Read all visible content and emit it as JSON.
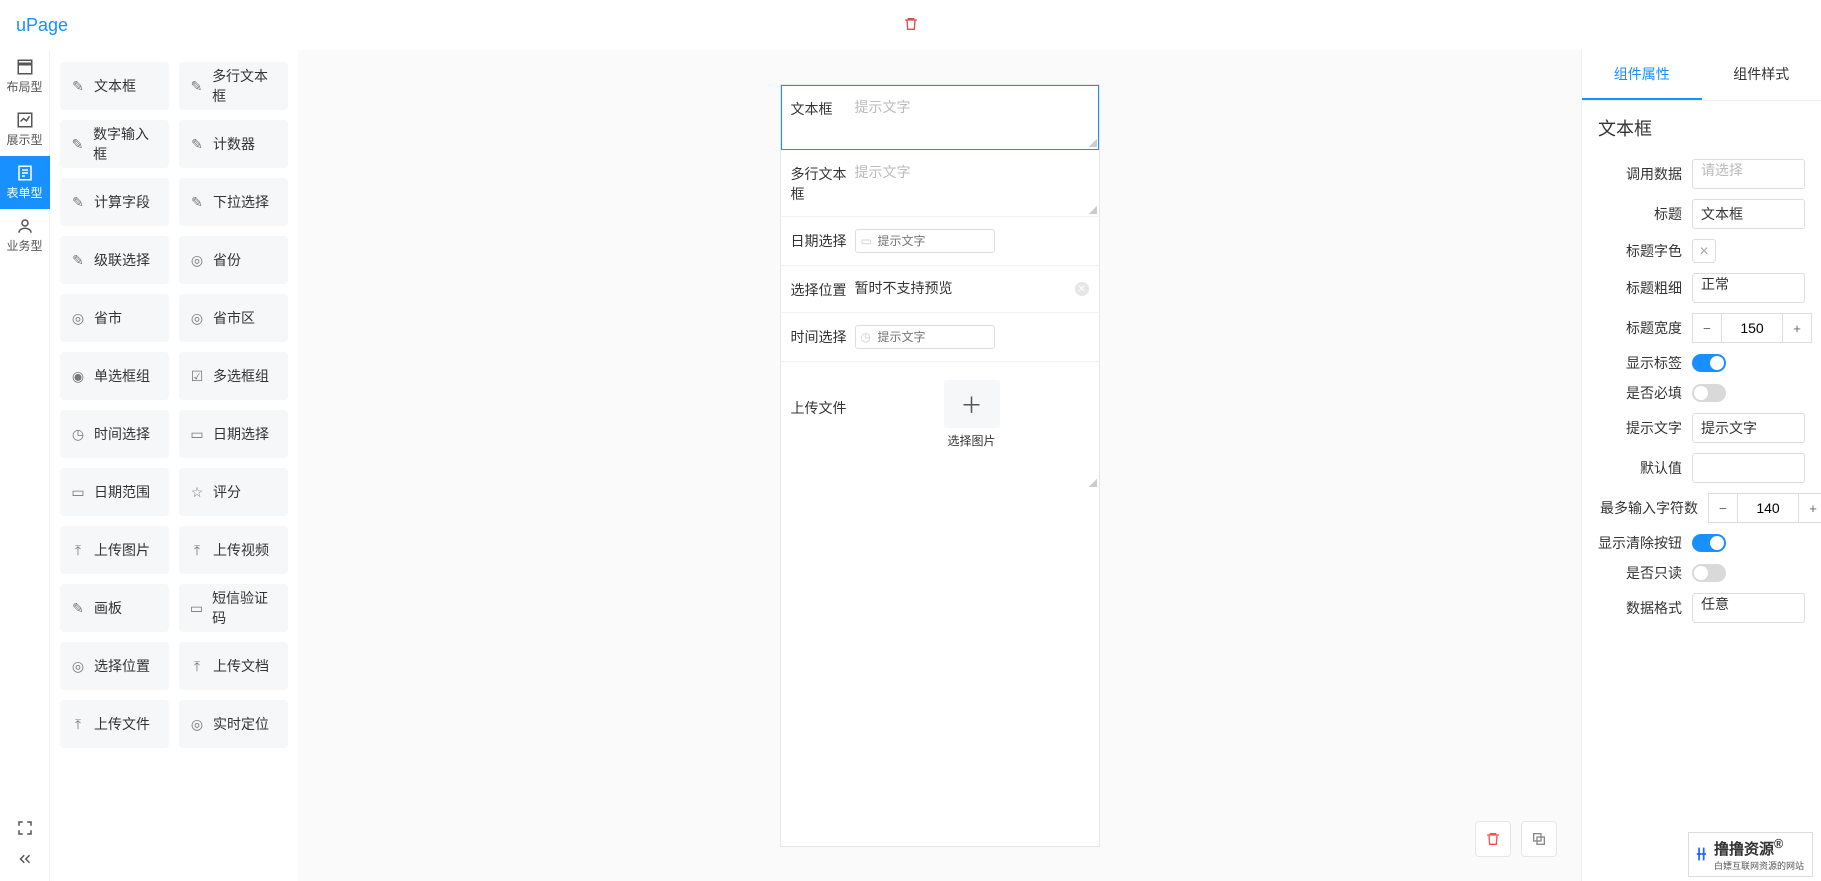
{
  "logo": "uPage",
  "rail": [
    {
      "id": "layout",
      "label": "布局型",
      "active": false
    },
    {
      "id": "display",
      "label": "展示型",
      "active": false
    },
    {
      "id": "form",
      "label": "表单型",
      "active": true
    },
    {
      "id": "biz",
      "label": "业务型",
      "active": false
    }
  ],
  "palette": [
    [
      "文本框",
      "多行文本框"
    ],
    [
      "数字输入框",
      "计数器"
    ],
    [
      "计算字段",
      "下拉选择"
    ],
    [
      "级联选择",
      "省份"
    ],
    [
      "省市",
      "省市区"
    ],
    [
      "单选框组",
      "多选框组"
    ],
    [
      "时间选择",
      "日期选择"
    ],
    [
      "日期范围",
      "评分"
    ],
    [
      "上传图片",
      "上传视频"
    ],
    [
      "画板",
      "短信验证码"
    ],
    [
      "选择位置",
      "上传文档"
    ],
    [
      "上传文件",
      "实时定位"
    ]
  ],
  "canvas": {
    "rows": [
      {
        "key": "text",
        "label": "文本框",
        "type": "text",
        "placeholder": "提示文字",
        "selected": true
      },
      {
        "key": "textarea",
        "label": "多行文本框",
        "type": "textarea",
        "placeholder": "提示文字"
      },
      {
        "key": "date",
        "label": "日期选择",
        "type": "date",
        "placeholder": "提示文字"
      },
      {
        "key": "location",
        "label": "选择位置",
        "type": "location",
        "value": "暂时不支持预览",
        "clearable": true
      },
      {
        "key": "time",
        "label": "时间选择",
        "type": "time",
        "placeholder": "提示文字"
      },
      {
        "key": "upload",
        "label": "上传文件",
        "type": "upload",
        "caption": "选择图片"
      }
    ]
  },
  "prop": {
    "tabs": [
      "组件属性",
      "组件样式"
    ],
    "active_tab": 0,
    "title": "文本框",
    "items": {
      "dataref_label": "调用数据",
      "dataref_placeholder": "请选择",
      "title_label": "标题",
      "title_value": "文本框",
      "title_color_label": "标题字色",
      "title_weight_label": "标题粗细",
      "title_weight_value": "正常",
      "title_width_label": "标题宽度",
      "title_width_value": "150",
      "show_label_label": "显示标签",
      "show_label_on": true,
      "required_label": "是否必填",
      "required_on": false,
      "placeholder_label": "提示文字",
      "placeholder_value": "提示文字",
      "default_label": "默认值",
      "default_value": "",
      "maxlen_label": "最多输入字符数",
      "maxlen_value": "140",
      "show_clear_label": "显示清除按钮",
      "show_clear_on": true,
      "readonly_label": "是否只读",
      "readonly_on": false,
      "dataformat_label": "数据格式",
      "dataformat_value": "任意"
    }
  },
  "watermark": {
    "title": "撸撸资源",
    "sub": "白嫖互联网资源的网站"
  }
}
